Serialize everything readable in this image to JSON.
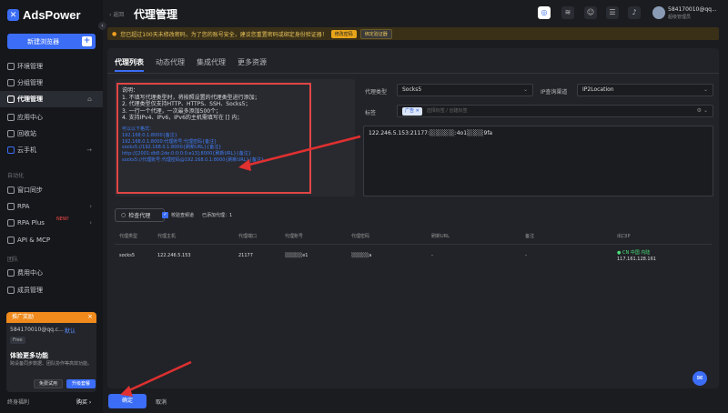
{
  "app": {
    "name": "AdsPower"
  },
  "sidebar": {
    "new_button": "新建浏览器",
    "items": [
      {
        "label": "环境管理"
      },
      {
        "label": "分组管理"
      },
      {
        "label": "代理管理"
      },
      {
        "label": "应用中心"
      },
      {
        "label": "回收站"
      },
      {
        "label": "云手机"
      }
    ],
    "section_automation": "自动化",
    "auto_items": [
      {
        "label": "窗口同步"
      },
      {
        "label": "RPA"
      },
      {
        "label": "RPA Plus"
      },
      {
        "label": "API & MCP"
      }
    ],
    "new_badge": "NEW!",
    "section_team": "团队",
    "team_items": [
      {
        "label": "费用中心"
      },
      {
        "label": "成员管理"
      }
    ],
    "promo": {
      "header": "推广奖励",
      "account": "584170010@qq.c...",
      "cloud": "默认",
      "plan": "Free",
      "title": "体验更多功能",
      "desc": "跨设备同步数据、团队协作等高效功能。",
      "btn_trial": "免费试用",
      "btn_upgrade": "升级套餐"
    },
    "footer_left": "终身福利",
    "footer_right": "购买 ›"
  },
  "topbar": {
    "back": "‹ 返回",
    "title": "代理管理",
    "user_name": "584170010@qq...",
    "user_role": "超级管理员"
  },
  "notice": {
    "text": "您已超过100天未修改密码，为了您的账号安全，建议您重置密码或绑定身份验证器！",
    "btn1": "修改密码",
    "btn2": "绑定验证器"
  },
  "tabs": [
    "代理列表",
    "动态代理",
    "集成代理",
    "更多资源"
  ],
  "instructions": {
    "lines": [
      "说明：",
      "1. 不填写代理类型时，将按照设置的代理类型进行添加；",
      "2. 代理类型仅支持HTTP、HTTPS、SSH、Socks5；",
      "3. 一行一个代理，一次最多添加500个；",
      "4. 支持IPv4、IPv6，IPv6的主机需填写在 [] 内；"
    ],
    "format_lines": [
      "可以以下格式：",
      "192.168.0.1:8000{备注}",
      "192.168.0.1:8000:代理账号:代理密码{备注}",
      "socks5://192.168.0.1:8000{刷新URL}{备注}",
      "http://[2001:db8:2de:0:0:0:0:e13]:8000{刷新URL}{备注}",
      "socks5://代理账号:代理密码@192.168.0.1:8000{刷新URL}{备注}"
    ]
  },
  "form": {
    "proxy_type_label": "代理类型",
    "proxy_type_value": "Socks5",
    "ip_query_label": "IP查询渠道",
    "ip_query_value": "IP2Location",
    "tag_label": "标签",
    "tag_chip": "广告 ✕",
    "tag_placeholder": "选择标签 / 创建标签",
    "textarea_value": "122.246.5.153:21177:░░░░░░:4o1░░░░9fa"
  },
  "actions": {
    "check_button": "检查代理",
    "checkbox_label": "校验查频道",
    "added": "已添加代理：1"
  },
  "table": {
    "headers": [
      "代理类型",
      "代理主机",
      "代理端口",
      "代理账号",
      "代理密码",
      "刷新URL",
      "备注",
      "出口IP"
    ],
    "row": {
      "type": "socks5",
      "host": "122.246.5.153",
      "port": "21177",
      "account": "░░░░░e1",
      "password": "░░░░░a",
      "refresh": "-",
      "note": "-",
      "exit_location": "● CN 中国 内陆",
      "exit_ip": "117.161.128.161"
    }
  },
  "footer": {
    "ok": "确定",
    "cancel": "取消"
  },
  "colors": {
    "accent": "#3b6df6",
    "highlight": "#e04545"
  }
}
